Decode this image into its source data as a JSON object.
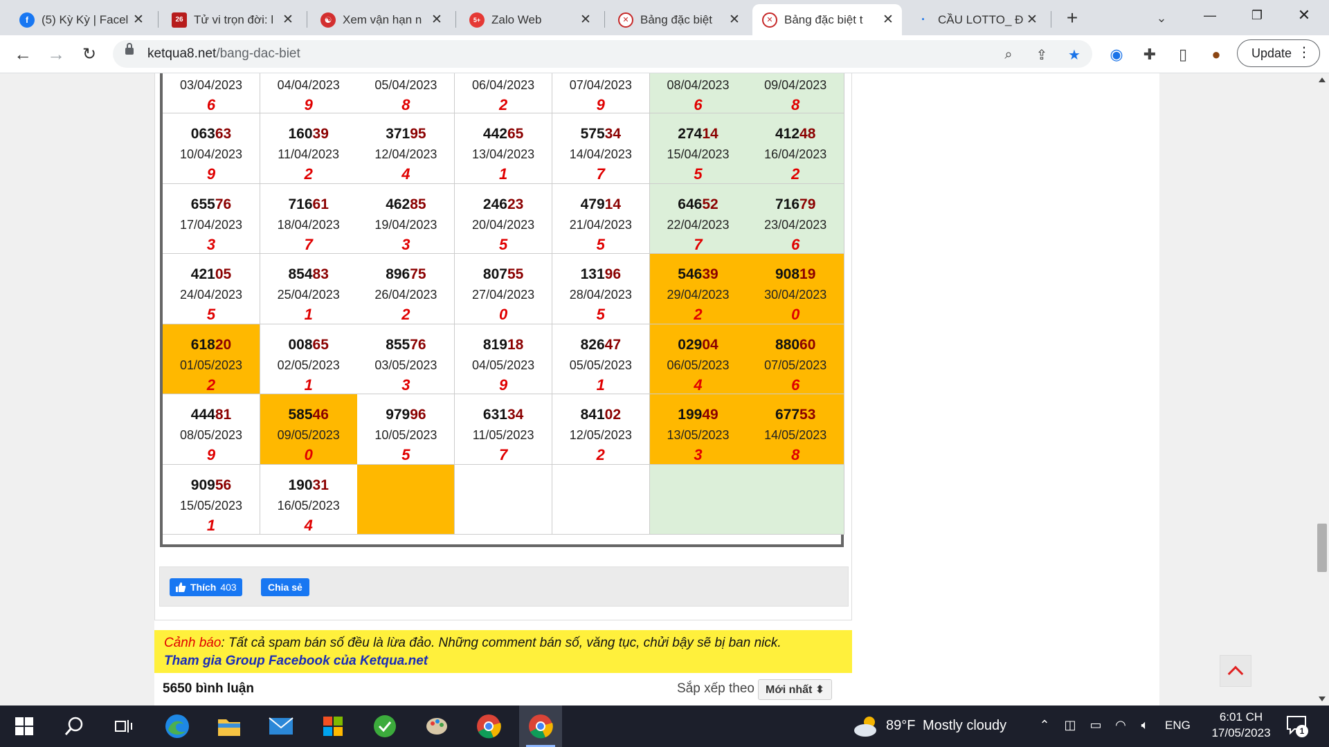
{
  "browser": {
    "tabs": [
      {
        "title": "(5) Kỳ Kỳ | Facel",
        "favicon": "facebook-icon",
        "color": "#1877f2"
      },
      {
        "title": "Tử vi trọn đời: l",
        "favicon": "calendar-icon",
        "color": "#b71c1c"
      },
      {
        "title": "Xem vận hạn n",
        "favicon": "yin-yang-icon",
        "color": "#d32f2f"
      },
      {
        "title": "Zalo Web",
        "favicon": "zalo-icon",
        "color": "#e53935"
      },
      {
        "title": "Bảng đặc biệt",
        "favicon": "ketqua-icon",
        "color": "#c62828"
      },
      {
        "title": "Bảng đặc biệt t",
        "favicon": "ketqua-icon",
        "color": "#c62828"
      },
      {
        "title": "CẦU LOTTO_ Đ",
        "favicon": "dot-icon",
        "color": "#1a73e8"
      }
    ],
    "active_tab": 5,
    "url_host": "ketqua8.net",
    "url_path": "/bang-dac-biet",
    "update_label": "Update"
  },
  "grid": {
    "colors": {
      "white": "#ffffff",
      "green": "#dcefd9",
      "orange": "#ffb800"
    },
    "first_row": [
      {
        "date": "03/04/2023",
        "digit": "6",
        "bg": "white"
      },
      {
        "date": "04/04/2023",
        "digit": "9",
        "bg": "white"
      },
      {
        "date": "05/04/2023",
        "digit": "8",
        "bg": "white"
      },
      {
        "date": "06/04/2023",
        "digit": "2",
        "bg": "white"
      },
      {
        "date": "07/04/2023",
        "digit": "9",
        "bg": "white"
      },
      {
        "date": "08/04/2023",
        "digit": "6",
        "bg": "green"
      },
      {
        "date": "09/04/2023",
        "digit": "8",
        "bg": "green"
      }
    ],
    "rows": [
      [
        {
          "head": "063",
          "tail": "63",
          "date": "10/04/2023",
          "digit": "9",
          "bg": "white"
        },
        {
          "head": "160",
          "tail": "39",
          "date": "11/04/2023",
          "digit": "2",
          "bg": "white"
        },
        {
          "head": "371",
          "tail": "95",
          "date": "12/04/2023",
          "digit": "4",
          "bg": "white"
        },
        {
          "head": "442",
          "tail": "65",
          "date": "13/04/2023",
          "digit": "1",
          "bg": "white"
        },
        {
          "head": "575",
          "tail": "34",
          "date": "14/04/2023",
          "digit": "7",
          "bg": "white"
        },
        {
          "head": "274",
          "tail": "14",
          "date": "15/04/2023",
          "digit": "5",
          "bg": "green"
        },
        {
          "head": "412",
          "tail": "48",
          "date": "16/04/2023",
          "digit": "2",
          "bg": "green"
        }
      ],
      [
        {
          "head": "655",
          "tail": "76",
          "date": "17/04/2023",
          "digit": "3",
          "bg": "white"
        },
        {
          "head": "716",
          "tail": "61",
          "date": "18/04/2023",
          "digit": "7",
          "bg": "white"
        },
        {
          "head": "462",
          "tail": "85",
          "date": "19/04/2023",
          "digit": "3",
          "bg": "white"
        },
        {
          "head": "246",
          "tail": "23",
          "date": "20/04/2023",
          "digit": "5",
          "bg": "white"
        },
        {
          "head": "479",
          "tail": "14",
          "date": "21/04/2023",
          "digit": "5",
          "bg": "white"
        },
        {
          "head": "646",
          "tail": "52",
          "date": "22/04/2023",
          "digit": "7",
          "bg": "green"
        },
        {
          "head": "716",
          "tail": "79",
          "date": "23/04/2023",
          "digit": "6",
          "bg": "green"
        }
      ],
      [
        {
          "head": "421",
          "tail": "05",
          "date": "24/04/2023",
          "digit": "5",
          "bg": "white"
        },
        {
          "head": "854",
          "tail": "83",
          "date": "25/04/2023",
          "digit": "1",
          "bg": "white"
        },
        {
          "head": "896",
          "tail": "75",
          "date": "26/04/2023",
          "digit": "2",
          "bg": "white"
        },
        {
          "head": "807",
          "tail": "55",
          "date": "27/04/2023",
          "digit": "0",
          "bg": "white"
        },
        {
          "head": "131",
          "tail": "96",
          "date": "28/04/2023",
          "digit": "5",
          "bg": "white"
        },
        {
          "head": "546",
          "tail": "39",
          "date": "29/04/2023",
          "digit": "2",
          "bg": "orange"
        },
        {
          "head": "908",
          "tail": "19",
          "date": "30/04/2023",
          "digit": "0",
          "bg": "orange"
        }
      ],
      [
        {
          "head": "618",
          "tail": "20",
          "date": "01/05/2023",
          "digit": "2",
          "bg": "orange"
        },
        {
          "head": "008",
          "tail": "65",
          "date": "02/05/2023",
          "digit": "1",
          "bg": "white"
        },
        {
          "head": "855",
          "tail": "76",
          "date": "03/05/2023",
          "digit": "3",
          "bg": "white"
        },
        {
          "head": "819",
          "tail": "18",
          "date": "04/05/2023",
          "digit": "9",
          "bg": "white"
        },
        {
          "head": "826",
          "tail": "47",
          "date": "05/05/2023",
          "digit": "1",
          "bg": "white"
        },
        {
          "head": "029",
          "tail": "04",
          "date": "06/05/2023",
          "digit": "4",
          "bg": "orange"
        },
        {
          "head": "880",
          "tail": "60",
          "date": "07/05/2023",
          "digit": "6",
          "bg": "orange"
        }
      ],
      [
        {
          "head": "444",
          "tail": "81",
          "date": "08/05/2023",
          "digit": "9",
          "bg": "white"
        },
        {
          "head": "585",
          "tail": "46",
          "date": "09/05/2023",
          "digit": "0",
          "bg": "orange"
        },
        {
          "head": "979",
          "tail": "96",
          "date": "10/05/2023",
          "digit": "5",
          "bg": "white"
        },
        {
          "head": "631",
          "tail": "34",
          "date": "11/05/2023",
          "digit": "7",
          "bg": "white"
        },
        {
          "head": "841",
          "tail": "02",
          "date": "12/05/2023",
          "digit": "2",
          "bg": "white"
        },
        {
          "head": "199",
          "tail": "49",
          "date": "13/05/2023",
          "digit": "3",
          "bg": "orange"
        },
        {
          "head": "677",
          "tail": "53",
          "date": "14/05/2023",
          "digit": "8",
          "bg": "orange"
        }
      ],
      [
        {
          "head": "909",
          "tail": "56",
          "date": "15/05/2023",
          "digit": "1",
          "bg": "white"
        },
        {
          "head": "190",
          "tail": "31",
          "date": "16/05/2023",
          "digit": "4",
          "bg": "white"
        },
        {
          "head": "",
          "tail": "",
          "date": "",
          "digit": "",
          "bg": "orange"
        },
        {
          "head": "",
          "tail": "",
          "date": "",
          "digit": "",
          "bg": "white"
        },
        {
          "head": "",
          "tail": "",
          "date": "",
          "digit": "",
          "bg": "white"
        },
        {
          "head": "",
          "tail": "",
          "date": "",
          "digit": "",
          "bg": "green"
        },
        {
          "head": "",
          "tail": "",
          "date": "",
          "digit": "",
          "bg": "green"
        }
      ]
    ]
  },
  "social": {
    "like_label": "Thích",
    "like_count": "403",
    "share_label": "Chia sẻ"
  },
  "warning": {
    "label": "Cảnh báo",
    "text": ": Tất cả spam bán số đều là lừa đảo. Những comment bán số, văng tục, chửi bậy sẽ bị ban nick.",
    "link": "Tham gia Group Facebook của Ketqua.net"
  },
  "comments": {
    "count_label": "5650 bình luận",
    "sort_label": "Sắp xếp theo",
    "sort_value": "Mới nhất ⬍"
  },
  "taskbar": {
    "weather_temp": "89°F",
    "weather_desc": "Mostly cloudy",
    "language": "ENG",
    "time": "6:01 CH",
    "date": "17/05/2023",
    "notification_count": "1"
  }
}
